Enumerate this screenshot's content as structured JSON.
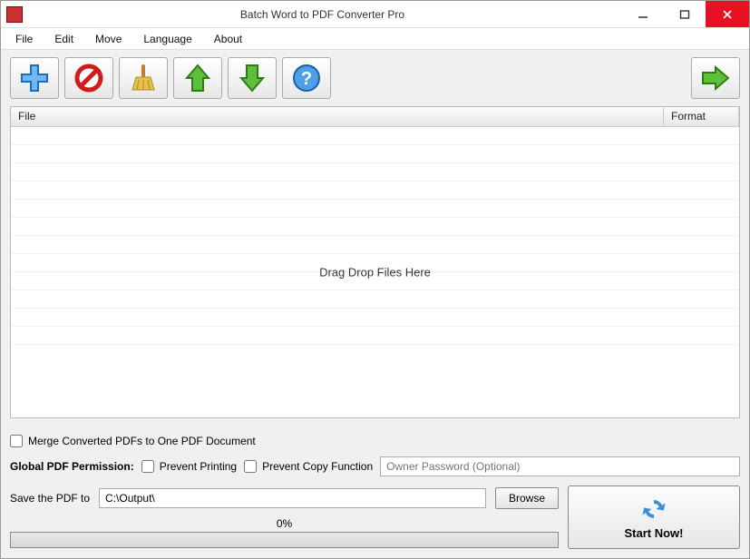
{
  "window": {
    "title": "Batch Word to PDF Converter Pro"
  },
  "menu": {
    "items": [
      "File",
      "Edit",
      "Move",
      "Language",
      "About"
    ]
  },
  "toolbar": {
    "add": "add",
    "remove": "remove",
    "clear": "clear",
    "moveUp": "move-up",
    "moveDown": "move-down",
    "help": "help",
    "next": "next"
  },
  "fileList": {
    "columns": {
      "file": "File",
      "format": "Format"
    },
    "dropHint": "Drag  Drop Files Here"
  },
  "options": {
    "mergeLabel": "Merge Converted PDFs to One PDF Document",
    "permissionLabel": "Global PDF Permission:",
    "preventPrintingLabel": "Prevent Printing",
    "preventCopyLabel": "Prevent Copy Function",
    "ownerPwPlaceholder": "Owner Password (Optional)"
  },
  "output": {
    "saveToLabel": "Save the PDF to",
    "path": "C:\\Output\\",
    "browseLabel": "Browse",
    "progressText": "0%",
    "startLabel": "Start Now!"
  }
}
